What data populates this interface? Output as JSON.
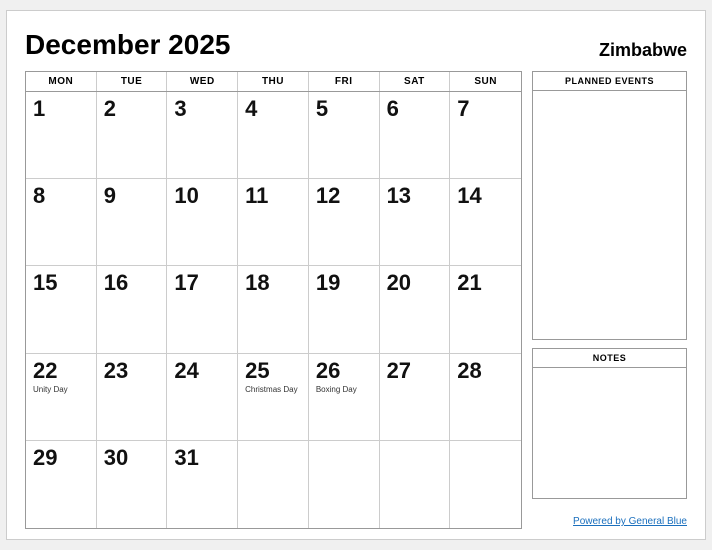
{
  "header": {
    "title": "December 2025",
    "country": "Zimbabwe"
  },
  "day_headers": [
    "MON",
    "TUE",
    "WED",
    "THU",
    "FRI",
    "SAT",
    "SUN"
  ],
  "weeks": [
    [
      {
        "day": "1",
        "holiday": ""
      },
      {
        "day": "2",
        "holiday": ""
      },
      {
        "day": "3",
        "holiday": ""
      },
      {
        "day": "4",
        "holiday": ""
      },
      {
        "day": "5",
        "holiday": ""
      },
      {
        "day": "6",
        "holiday": ""
      },
      {
        "day": "7",
        "holiday": ""
      }
    ],
    [
      {
        "day": "8",
        "holiday": ""
      },
      {
        "day": "9",
        "holiday": ""
      },
      {
        "day": "10",
        "holiday": ""
      },
      {
        "day": "11",
        "holiday": ""
      },
      {
        "day": "12",
        "holiday": ""
      },
      {
        "day": "13",
        "holiday": ""
      },
      {
        "day": "14",
        "holiday": ""
      }
    ],
    [
      {
        "day": "15",
        "holiday": ""
      },
      {
        "day": "16",
        "holiday": ""
      },
      {
        "day": "17",
        "holiday": ""
      },
      {
        "day": "18",
        "holiday": ""
      },
      {
        "day": "19",
        "holiday": ""
      },
      {
        "day": "20",
        "holiday": ""
      },
      {
        "day": "21",
        "holiday": ""
      }
    ],
    [
      {
        "day": "22",
        "holiday": "Unity Day"
      },
      {
        "day": "23",
        "holiday": ""
      },
      {
        "day": "24",
        "holiday": ""
      },
      {
        "day": "25",
        "holiday": "Christmas Day"
      },
      {
        "day": "26",
        "holiday": "Boxing Day"
      },
      {
        "day": "27",
        "holiday": ""
      },
      {
        "day": "28",
        "holiday": ""
      }
    ],
    [
      {
        "day": "29",
        "holiday": ""
      },
      {
        "day": "30",
        "holiday": ""
      },
      {
        "day": "31",
        "holiday": ""
      },
      {
        "day": "",
        "holiday": ""
      },
      {
        "day": "",
        "holiday": ""
      },
      {
        "day": "",
        "holiday": ""
      },
      {
        "day": "",
        "holiday": ""
      }
    ]
  ],
  "sidebar": {
    "planned_events_label": "PLANNED EVENTS",
    "notes_label": "NOTES"
  },
  "footer": {
    "link_text": "Powered by General Blue"
  }
}
